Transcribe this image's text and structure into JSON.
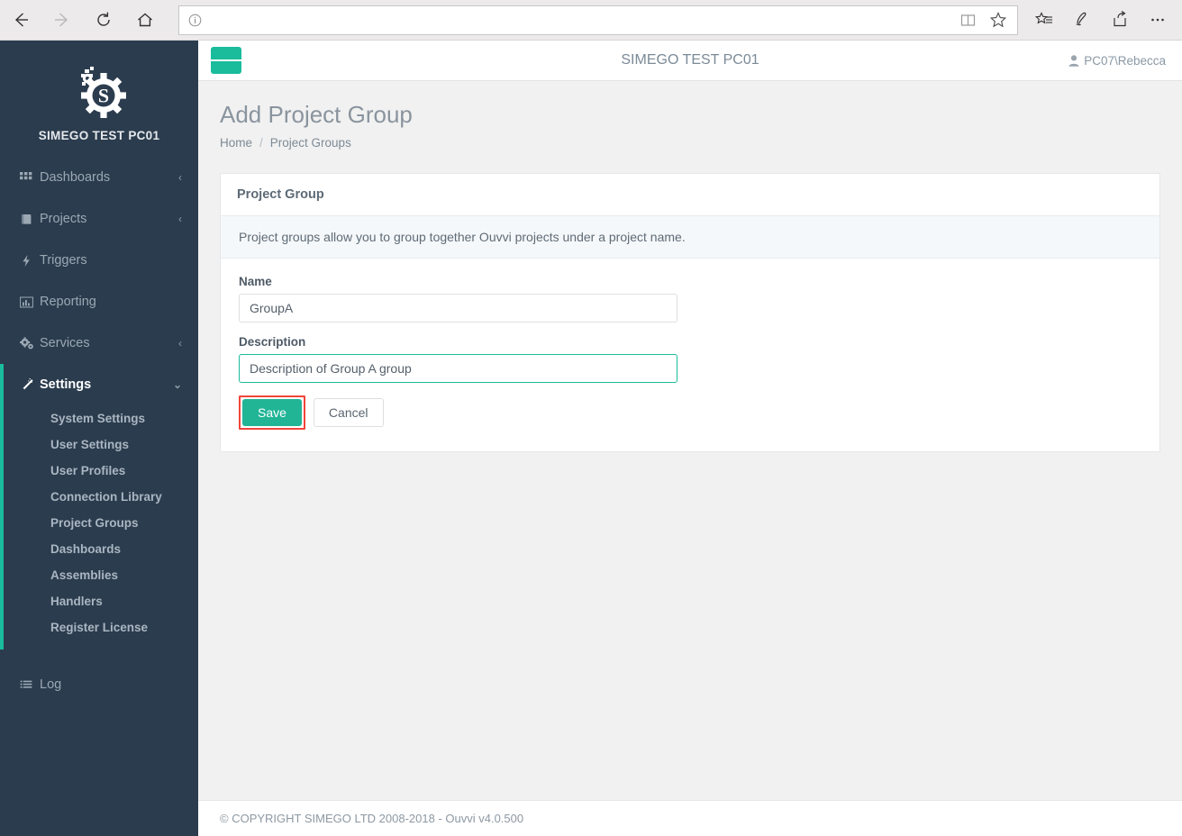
{
  "browser": {
    "back_icon": "arrow-left-icon",
    "forward_icon": "arrow-right-icon",
    "refresh_icon": "refresh-icon",
    "home_icon": "home-icon",
    "address_value": "",
    "address_placeholder": "",
    "info_icon": "info-icon",
    "reading_view_icon": "book-icon",
    "favorite_icon": "star-icon",
    "favorites_hub_icon": "favorites-list-icon",
    "notes_icon": "pen-icon",
    "share_icon": "share-icon",
    "more_icon": "ellipsis-icon"
  },
  "sidebar": {
    "brand": "SIMEGO TEST PC01",
    "logo_icon": "simego-gear-logo",
    "items": [
      {
        "label": "Dashboards",
        "icon": "grid-icon",
        "caret": "‹",
        "active": false
      },
      {
        "label": "Projects",
        "icon": "book-icon",
        "caret": "‹",
        "active": false
      },
      {
        "label": "Triggers",
        "icon": "bolt-icon",
        "caret": "",
        "active": false
      },
      {
        "label": "Reporting",
        "icon": "bar-chart-icon",
        "caret": "",
        "active": false
      },
      {
        "label": "Services",
        "icon": "gears-icon",
        "caret": "‹",
        "active": false
      },
      {
        "label": "Settings",
        "icon": "magic-wand-icon",
        "caret": "⌄",
        "active": true
      }
    ],
    "submenu": [
      "System Settings",
      "User Settings",
      "User Profiles",
      "Connection Library",
      "Project Groups",
      "Dashboards",
      "Assemblies",
      "Handlers",
      "Register License"
    ],
    "bottom_item": {
      "label": "Log",
      "icon": "list-icon"
    }
  },
  "topbar": {
    "menu_toggle_icon": "hamburger-icon",
    "title": "SIMEGO TEST PC01",
    "user_icon": "user-icon",
    "user": "PC07\\Rebecca"
  },
  "page": {
    "title": "Add Project Group",
    "breadcrumb": {
      "home": "Home",
      "separator": "/",
      "current": "Project Groups"
    }
  },
  "panel": {
    "header": "Project Group",
    "note": "Project groups allow you to group together Ouvvi projects under a project name.",
    "fields": [
      {
        "label": "Name",
        "value": "GroupA",
        "placeholder": "",
        "focused": false
      },
      {
        "label": "Description",
        "value": "Description of Group A group",
        "placeholder": "",
        "focused": true
      }
    ],
    "save_label": "Save",
    "cancel_label": "Cancel"
  },
  "footer": {
    "copyright": "© COPYRIGHT SIMEGO LTD 2008-2018 - Ouvvi v4.0.500"
  },
  "colors": {
    "accent_teal": "#1abc9c",
    "sidebar_bg": "#2b3c4e",
    "content_bg": "#f1f1f1",
    "highlight_red": "#f0463a",
    "save_green": "#21b596"
  }
}
